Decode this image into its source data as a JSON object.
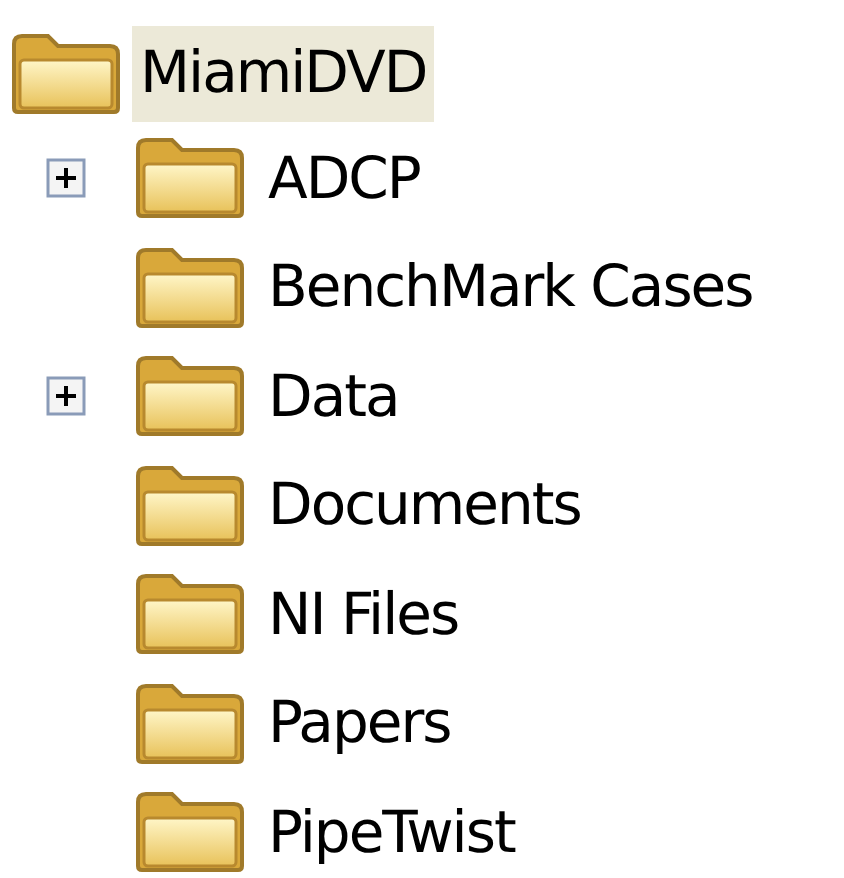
{
  "tree": {
    "label": "MiamiDVD",
    "selected": true,
    "children": [
      {
        "label": "ADCP",
        "collapsed": true,
        "selected": false
      },
      {
        "label": "BenchMark Cases",
        "collapsed": false,
        "selected": false
      },
      {
        "label": "Data",
        "collapsed": true,
        "selected": false
      },
      {
        "label": "Documents",
        "collapsed": false,
        "selected": false
      },
      {
        "label": "NI Files",
        "collapsed": false,
        "selected": false
      },
      {
        "label": "Papers",
        "collapsed": false,
        "selected": false
      },
      {
        "label": "PipeTwist",
        "collapsed": false,
        "selected": false
      }
    ]
  }
}
